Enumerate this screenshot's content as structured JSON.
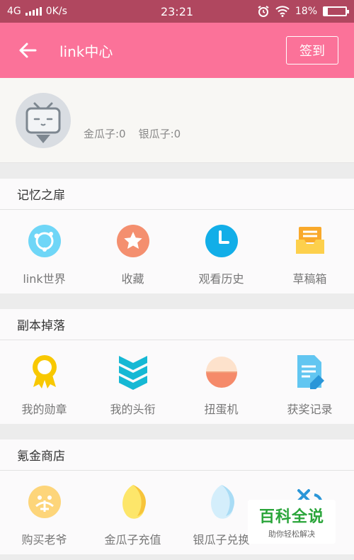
{
  "status_bar": {
    "network": "4G",
    "speed": "0K/s",
    "time": "23:21",
    "battery": "18%",
    "battery_level": 0.18
  },
  "app_bar": {
    "title": "link中心",
    "checkin": "签到"
  },
  "profile": {
    "gold": "金瓜子:0",
    "silver": "银瓜子:0"
  },
  "sections": [
    {
      "title": "记忆之扉",
      "items": [
        {
          "label": "link世界",
          "icon": "planet-icon"
        },
        {
          "label": "收藏",
          "icon": "star-icon"
        },
        {
          "label": "观看历史",
          "icon": "clock-icon"
        },
        {
          "label": "草稿箱",
          "icon": "drafts-icon"
        }
      ]
    },
    {
      "title": "副本掉落",
      "items": [
        {
          "label": "我的勋章",
          "icon": "medal-icon"
        },
        {
          "label": "我的头衔",
          "icon": "chevron-rank-icon"
        },
        {
          "label": "扭蛋机",
          "icon": "gacha-egg-icon"
        },
        {
          "label": "获奖记录",
          "icon": "award-record-icon"
        }
      ]
    },
    {
      "title": "氪金商店",
      "items": [
        {
          "label": "购买老爷",
          "icon": "vip-icon"
        },
        {
          "label": "金瓜子充值",
          "icon": "gold-seed-icon"
        },
        {
          "label": "银瓜子兑换",
          "icon": "silver-seed-icon"
        },
        {
          "label": "",
          "icon": "exchange-icon"
        }
      ]
    }
  ],
  "watermark": {
    "brand": "百科全说",
    "slogan": "助你轻松解决"
  },
  "colors": {
    "accent": "#fb7299",
    "status_bar": "#b0475f"
  }
}
